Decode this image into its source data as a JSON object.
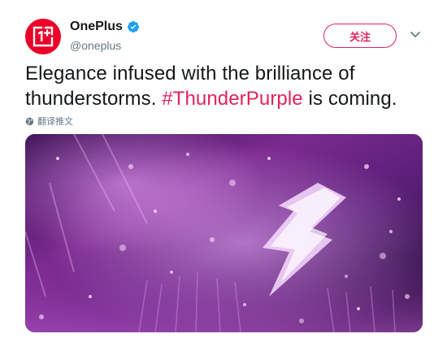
{
  "tweet": {
    "author": {
      "name": "OnePlus",
      "handle": "@oneplus",
      "verified": true,
      "avatar_icon": "oneplus-logo-icon",
      "avatar_color": "#eb0029"
    },
    "follow_button_label": "关注",
    "text_main": "Elegance infused with the brilliance of thunderstorms. ",
    "hashtag": "#ThunderPurple",
    "text_tail": " is coming.",
    "translate_label": "翻译推文",
    "media": {
      "kind": "image",
      "alt_description": "purple lightning bolt over glowing particle field"
    }
  },
  "colors": {
    "accent": "#e0245e",
    "verified": "#1da1f2",
    "secondary_text": "#657786"
  }
}
